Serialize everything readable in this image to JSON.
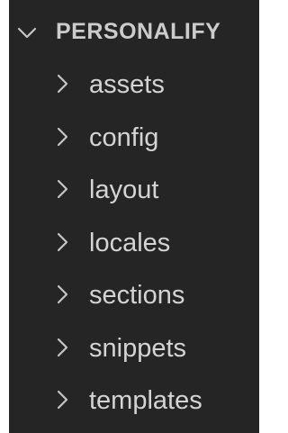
{
  "explorer": {
    "folder_name": "PERSONALIFY",
    "expanded_icon": "chevron-down-icon",
    "items": [
      {
        "label": "assets",
        "icon": "chevron-right-icon"
      },
      {
        "label": "config",
        "icon": "chevron-right-icon"
      },
      {
        "label": "layout",
        "icon": "chevron-right-icon"
      },
      {
        "label": "locales",
        "icon": "chevron-right-icon"
      },
      {
        "label": "sections",
        "icon": "chevron-right-icon"
      },
      {
        "label": "snippets",
        "icon": "chevron-right-icon"
      },
      {
        "label": "templates",
        "icon": "chevron-right-icon"
      }
    ]
  },
  "colors": {
    "panel_background": "#252526",
    "text": "#cccccc",
    "page_background": "#ffffff"
  }
}
